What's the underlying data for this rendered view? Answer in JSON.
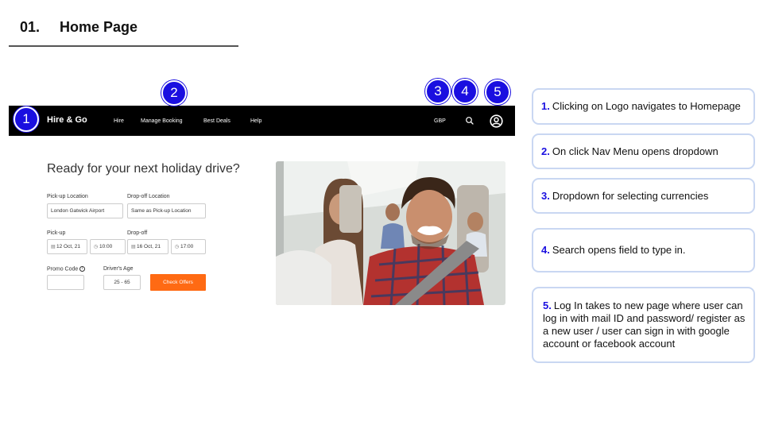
{
  "slide": {
    "number": "01.",
    "title": "Home Page"
  },
  "site": {
    "logo": "Hire & Go",
    "nav": [
      "Hire",
      "Manage Booking",
      "Best Deals",
      "Help"
    ],
    "currency": "GBP",
    "icons": {
      "search": "search-icon",
      "account": "user-circle-icon"
    },
    "hero_title": "Ready for your next holiday drive?",
    "pickup_location": {
      "label": "Pick-up Location",
      "value": "London Gatwick Airport"
    },
    "dropoff_location": {
      "label": "Drop-off Location",
      "value": "Same as Pick-up Location"
    },
    "pickup": {
      "label": "Pick-up",
      "date": "12 Oct, 21",
      "time": "10:00"
    },
    "dropoff": {
      "label": "Drop-off",
      "date": "16 Oct, 21",
      "time": "17:00"
    },
    "promo_code": {
      "label": "Promo Code",
      "value": ""
    },
    "drivers_age": {
      "label": "Driver's Age",
      "value": "25 - 65"
    },
    "cta": "Check Offers",
    "accent_color": "#ff6a13"
  },
  "markers": [
    "1",
    "2",
    "3",
    "4",
    "5"
  ],
  "notes": [
    {
      "num": "1.",
      "text": "Clicking on Logo navigates to Homepage"
    },
    {
      "num": "2.",
      "text": "On click Nav Menu opens dropdown"
    },
    {
      "num": "3.",
      "text": "Dropdown for selecting currencies"
    },
    {
      "num": "4.",
      "text": "Search opens field to type in."
    },
    {
      "num": "5.",
      "text": "Log In takes to new page where user can log in with mail ID and password/ register as a new user / user can sign in with google account or facebook account"
    }
  ],
  "marker_color": "#1a0fe0"
}
